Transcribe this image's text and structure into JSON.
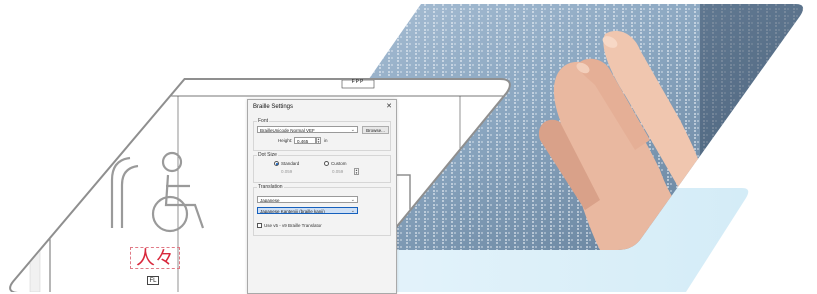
{
  "dialog": {
    "title": "Braille Settings",
    "close_label": "✕",
    "font_group": {
      "label": "Font",
      "font_value": "BrailleUnicode  Normal  VEF",
      "browse_label": "Browse...",
      "height_label": "Height:",
      "height_value": "0.465",
      "height_unit": "in"
    },
    "dot_size_group": {
      "label": "Dot Size",
      "standard_label": "Standard",
      "standard_value": "0.059",
      "custom_label": "Custom",
      "custom_value": "0.059"
    },
    "translation_group": {
      "label": "Translation",
      "language_value": "Japanese",
      "mode_value": "Japanese Kanteniji (braille kanji)",
      "legacy_label": "Use v5 - v9 Braille Translator"
    }
  },
  "drawing": {
    "top_marker": "FPP",
    "kanji_text": "人々",
    "bottom_marker": "FL"
  },
  "colors": {
    "accent_blue": "#1560bd",
    "highlight_blue": "#cfe0f5",
    "kanji_red": "#d9283c",
    "sign_outline": "#9a9a9a"
  }
}
